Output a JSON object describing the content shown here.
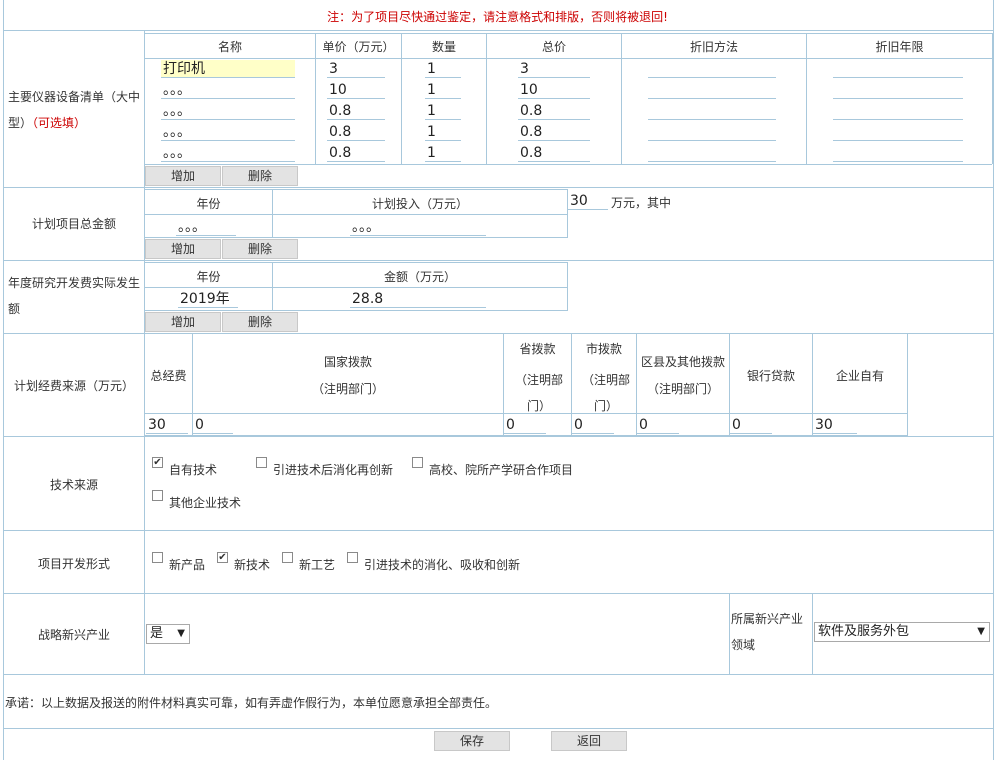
{
  "notice": "注：为了项目尽快通过鉴定，请注意格式和排版，否则将被退回!",
  "equipment": {
    "label_main": "主要仪器设备清单（大中型）",
    "label_optional": "（可选填）",
    "headers": [
      "名称",
      "单价（万元）",
      "数量",
      "总价",
      "折旧方法",
      "折旧年限"
    ],
    "rows": [
      [
        "打印机",
        "3",
        "1",
        "3",
        "",
        ""
      ],
      [
        "。。。",
        "10",
        "1",
        "10",
        "",
        ""
      ],
      [
        "。。。",
        "0.8",
        "1",
        "0.8",
        "",
        ""
      ],
      [
        "。。。",
        "0.8",
        "1",
        "0.8",
        "",
        ""
      ],
      [
        "。。。",
        "0.8",
        "1",
        "0.8",
        "",
        ""
      ]
    ],
    "add": "增加",
    "delete": "删除"
  },
  "plan_total": {
    "label": "计划项目总金额",
    "headers": [
      "年份",
      "计划投入（万元）"
    ],
    "row": [
      "。。。",
      "。。。"
    ],
    "amount": "30",
    "suffix": "万元，其中",
    "add": "增加",
    "delete": "删除"
  },
  "annual_rd": {
    "label": "年度研究开发费实际发生额",
    "headers": [
      "年份",
      "金额（万元）"
    ],
    "row": [
      "2019年",
      "28.8"
    ],
    "add": "增加",
    "delete": "删除"
  },
  "funding": {
    "label": "计划经费来源（万元）",
    "headers": [
      "总经费",
      "国家拨款",
      "省拨款",
      "市拨款",
      "区县及其他拨款",
      "银行贷款",
      "企业自有"
    ],
    "sub_national": "（注明部门）",
    "sub_prov": "（注明部门）",
    "sub_city": "（注明部门）",
    "sub_county": "（注明部门）",
    "values": [
      "30",
      "0",
      "0",
      "0",
      "0",
      "0",
      "30"
    ]
  },
  "tech_source": {
    "label": "技术来源",
    "options": [
      "自有技术",
      "引进技术后消化再创新",
      "高校、院所产学研合作项目",
      "其他企业技术"
    ],
    "checked": [
      true,
      false,
      false,
      false
    ]
  },
  "dev_form": {
    "label": "项目开发形式",
    "options": [
      "新产品",
      "新技术",
      "新工艺",
      "引进技术的消化、吸收和创新"
    ],
    "checked": [
      false,
      true,
      false,
      false
    ]
  },
  "strategic": {
    "label": "战略新兴产业",
    "value": "是",
    "field_label": "所属新兴产业领域",
    "field_value": "软件及服务外包"
  },
  "promise": "承诺：以上数据及报送的附件材料真实可靠，如有弄虚作假行为，本单位愿意承担全部责任。",
  "save": "保存",
  "back": "返回",
  "colors": {
    "border": "#a8c8dc",
    "notice": "#cc0000",
    "highlight": "#ffffc8",
    "button": "#e3e3e3"
  }
}
